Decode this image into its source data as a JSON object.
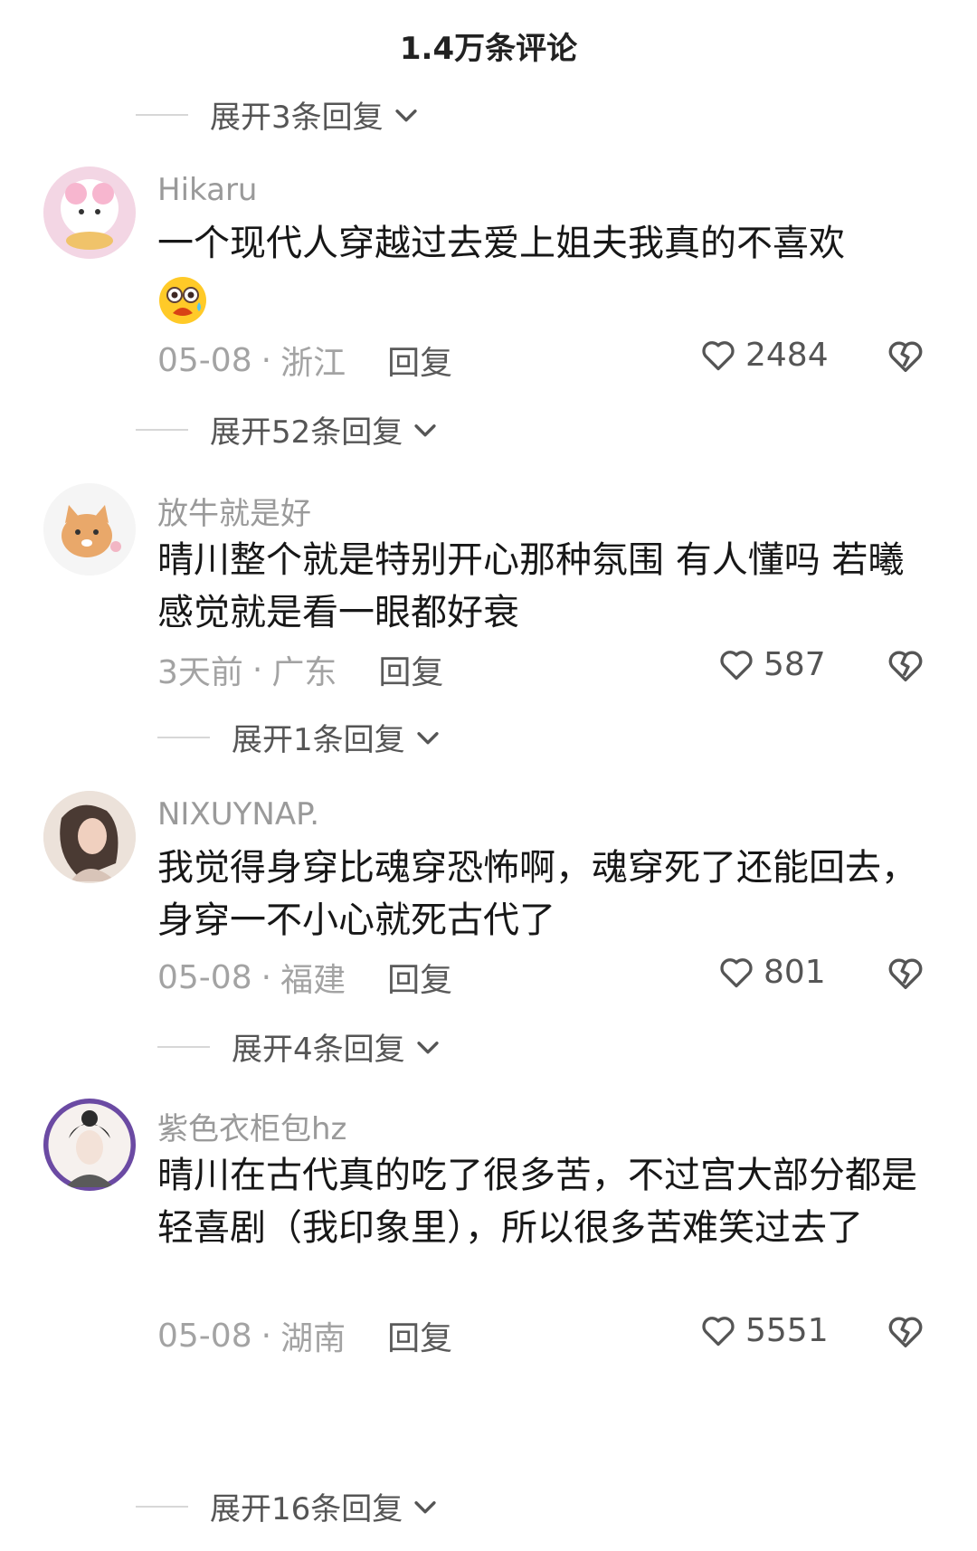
{
  "header": {
    "title": "1.4万条评论"
  },
  "expand_top": {
    "label": "展开3条回复"
  },
  "comments": [
    {
      "username": "Hikaru",
      "text": "一个现代人穿越过去爱上姐夫我真的不喜欢",
      "emoji": "flushed-scared-emoji",
      "date": "05-08",
      "location": "浙江",
      "reply_label": "回复",
      "likes": "2484",
      "expand_label": "展开52条回复"
    },
    {
      "username": "放牛就是好",
      "text": "晴川整个就是特别开心那种氛围 有人懂吗 若曦感觉就是看一眼都好衰",
      "date": "3天前",
      "location": "广东",
      "reply_label": "回复",
      "likes": "587",
      "expand_label": "展开1条回复"
    },
    {
      "username": "NIXUYNAP.",
      "text": "我觉得身穿比魂穿恐怖啊，魂穿死了还能回去，身穿一不小心就死古代了",
      "date": "05-08",
      "location": "福建",
      "reply_label": "回复",
      "likes": "801",
      "expand_label": "展开4条回复"
    },
    {
      "username": "紫色衣柜包hz",
      "text": "晴川在古代真的吃了很多苦，不过宫大部分都是轻喜剧（我印象里），所以很多苦难笑过去了",
      "date": "05-08",
      "location": "湖南",
      "reply_label": "回复",
      "likes": "5551",
      "expand_label": "展开16条回复"
    }
  ],
  "meta_separator": "·",
  "icons": {
    "like": "heart-outline-icon",
    "dislike": "broken-heart-icon",
    "expand": "chevron-down-icon"
  },
  "colors": {
    "text": "#171717",
    "muted": "#9a9a9a",
    "reply": "#5a5a5a"
  }
}
